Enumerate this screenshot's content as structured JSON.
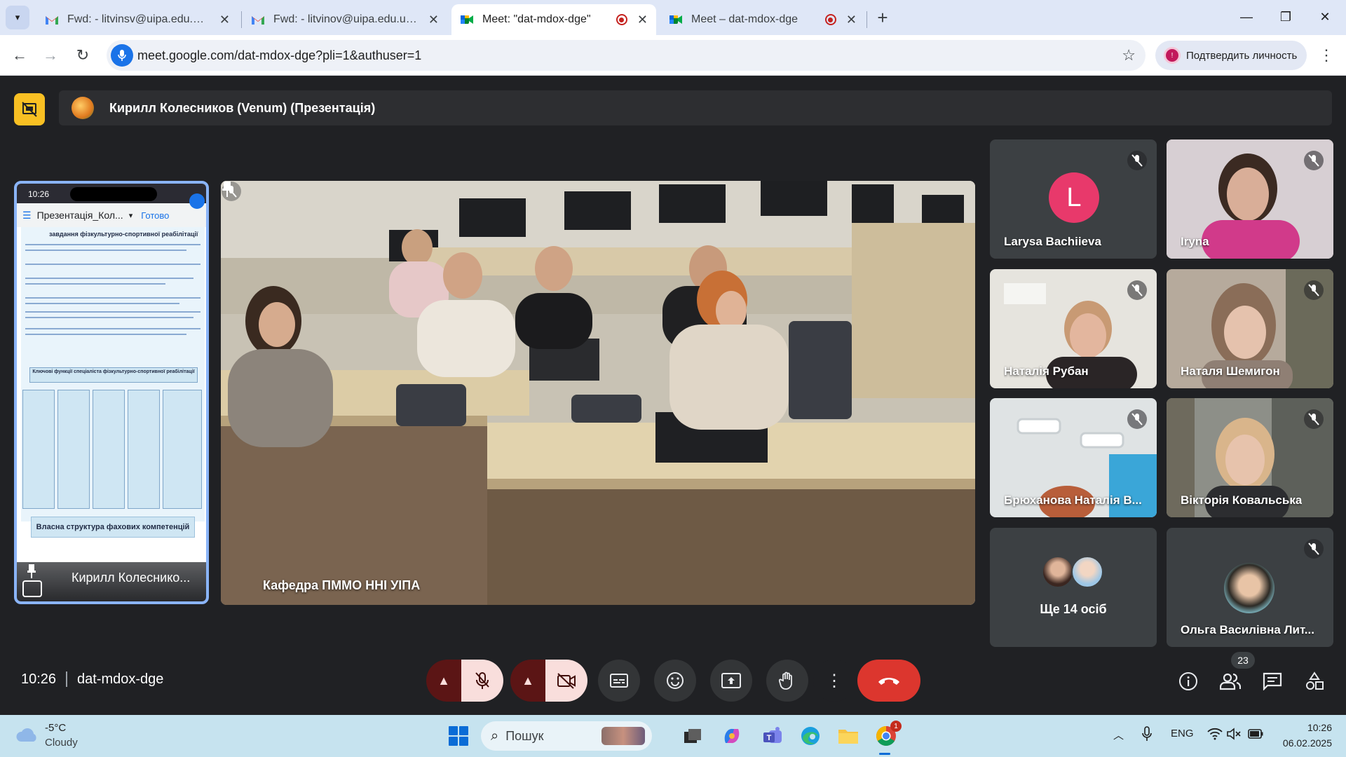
{
  "browser": {
    "tabs": [
      {
        "title": "Fwd: - litvinsv@uipa.edu.ua - пошта",
        "icon": "gmail-icon",
        "active": false,
        "recording": false
      },
      {
        "title": "Fwd: - litvinov@uipa.edu.ua - Пошта",
        "icon": "gmail-icon",
        "active": false,
        "recording": false
      },
      {
        "title": "Meet: \"dat-mdox-dge\"",
        "icon": "meet-icon",
        "active": true,
        "recording": true
      },
      {
        "title": "Meet – dat-mdox-dge",
        "icon": "meet-icon",
        "active": false,
        "recording": true
      }
    ],
    "url": "meet.google.com/dat-mdox-dge?pli=1&authuser=1",
    "profile_chip": "Подтвердить личность"
  },
  "meet": {
    "presentation_title": "Кирилл Колесников (Venum) (Презентація)",
    "shared_screen": {
      "presenter_name": "Кирилл Колеснико...",
      "phone_time": "10:26",
      "app_title": "Презентація_Кол...",
      "app_action": "Готово",
      "doc_heading": "завдання фізкультурно-спортивної реабілітації",
      "doc_box_title": "Ключові функції спеціаліста фізкультурно-спортивної реабілітації",
      "doc2_title": "Власна структура фахових компетенцій"
    },
    "main_video": {
      "caption": "Кафедра ПММО ННІ УІПА"
    },
    "participants": [
      {
        "name": "Larysa Bachiieva",
        "initial": "L",
        "muted": true,
        "type": "avatar"
      },
      {
        "name": "Iryna",
        "muted": true,
        "type": "video"
      },
      {
        "name": "Наталія Рубан",
        "muted": true,
        "type": "video"
      },
      {
        "name": "Наталя Шемигон",
        "muted": true,
        "type": "video"
      },
      {
        "name": "Брюханова Наталія В...",
        "muted": true,
        "type": "video"
      },
      {
        "name": "Вікторія Ковальська",
        "muted": true,
        "type": "video"
      },
      {
        "name": "Ще 14 осіб",
        "muted": false,
        "type": "more"
      },
      {
        "name": "Ольга Василівна Лит...",
        "muted": true,
        "type": "photo"
      }
    ],
    "footer": {
      "time": "10:26",
      "meeting_code": "dat-mdox-dge",
      "people_count": "23"
    },
    "colors": {
      "background": "#202124",
      "hangup": "#dc362e",
      "muted_control": "#f9dedc",
      "active_border": "#8ab4f8"
    }
  },
  "taskbar": {
    "weather_temp": "-5°C",
    "weather_desc": "Cloudy",
    "search_placeholder": "Пошук",
    "language": "ENG",
    "clock_time": "10:26",
    "clock_date": "06.02.2025",
    "chrome_badge": "1"
  }
}
